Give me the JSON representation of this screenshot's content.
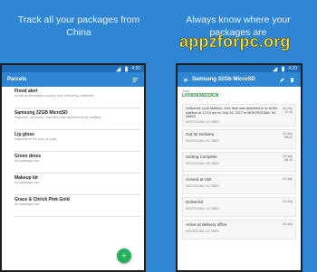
{
  "captions": {
    "left": "Track all your packages from China",
    "right": "Always know where your packages are"
  },
  "watermark": "appzforpc.org",
  "left_phone": {
    "status": {
      "time": "4:20"
    },
    "appbar": {
      "title": "Parcels"
    },
    "parcels": [
      {
        "name": "Flood alert",
        "detail": "Arrival at destination country, end of tracking, delivered ..."
      },
      {
        "name": "Samsung 32GB MicroSD",
        "detail": "Delivered. Accepted, Your item was delivered at the mailbox..."
      },
      {
        "name": "Lip gloss",
        "detail": "Delivered to the pick-up point"
      },
      {
        "name": "Green dress",
        "detail": "No packages are"
      },
      {
        "name": "Makeup kit",
        "detail": "No packages are"
      },
      {
        "name": "Grace & Chrick Pink Gold",
        "detail": "No packages are"
      }
    ],
    "fab": "+"
  },
  "right_phone": {
    "status": {
      "time": "4:20"
    },
    "appbar": {
      "title": "Samsung 32Gb MicroSD"
    },
    "tracking_label": "Track",
    "tracking_number": "LK093836533CN",
    "summary": {
      "text": "Delivered, In/At Mailbox. Your item was delivered in or at the mailbox at 12:19 pm on July 24, 2017 in MONTEZUMA, NC 28653.",
      "location": "MONTEZUMA, NC 28653",
      "date": "24 July 12:19"
    },
    "events": [
      {
        "name": "Out for Delivery",
        "location": "MONTEZUMA, NC 28653",
        "date": "24 July 08:24"
      },
      {
        "name": "Sorting Complete",
        "location": "MONTEZUMA, NC 28653",
        "date": "24 July 08:14"
      },
      {
        "name": "Arrived at Unit",
        "location": "MONTEZUMA, NC 28653",
        "date": "24 July"
      },
      {
        "name": "Delivered",
        "location": "MONTEZUMA, NC 28653",
        "date": "24 July"
      },
      {
        "name": "Arrive at delivery office",
        "location": "MONTEZUMA, NC 28653",
        "date": "24 July"
      }
    ]
  },
  "colors": {
    "background": "#2f86d4",
    "appbar": "#2f86d4",
    "statusbar": "#1f6cb6",
    "fab": "#25b15a",
    "tracking": "#2b8c40",
    "watermark": "#ffe53a"
  }
}
